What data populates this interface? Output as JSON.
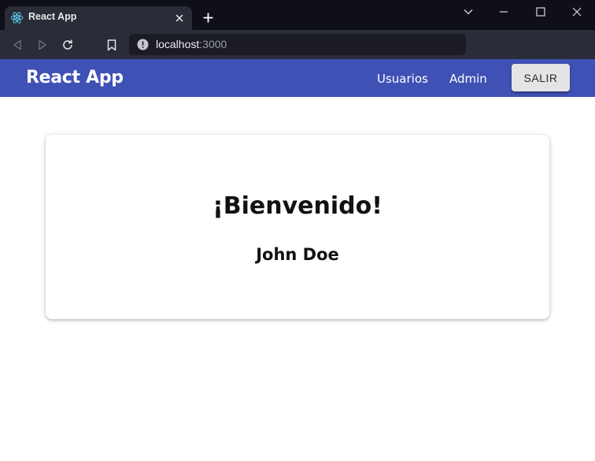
{
  "browser": {
    "tab": {
      "title": "React App",
      "favicon": "react-logo-icon",
      "close_icon": "close-icon"
    },
    "new_tab_icon": "plus-icon",
    "window_controls": [
      "chevron-down-icon",
      "minimize-icon",
      "maximize-icon",
      "close-icon"
    ],
    "toolbar": {
      "back_icon": "back-arrow-icon",
      "forward_icon": "forward-arrow-icon",
      "reload_icon": "reload-icon",
      "bookmark_icon": "bookmark-icon",
      "site_info_icon": "info-icon",
      "url_host": "localhost",
      "url_port": ":3000"
    }
  },
  "app": {
    "brand": "React App",
    "nav": [
      {
        "label": "Usuarios"
      },
      {
        "label": "Admin"
      }
    ],
    "logout_label": "SALIR",
    "welcome_card": {
      "heading": "¡Bienvenido!",
      "user_name": "John Doe"
    }
  },
  "colors": {
    "appbar": "#3f51b5",
    "browser_frame": "#0e0f19",
    "browser_toolbar": "#2a2c38",
    "logout_button": "#e4e4e6"
  }
}
